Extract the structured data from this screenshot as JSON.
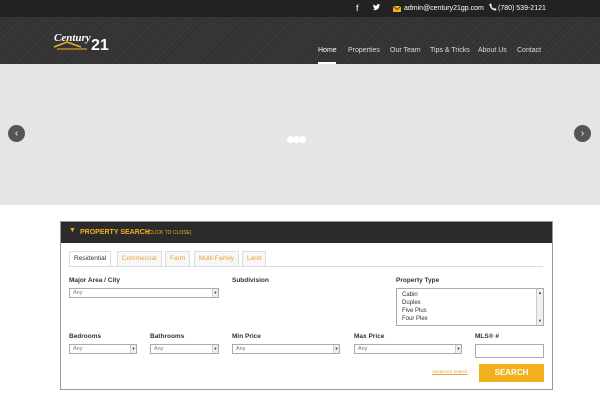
{
  "topbar": {
    "icons": [
      "facebook-icon",
      "twitter-icon",
      "envelope-icon",
      "phone-icon"
    ],
    "email": "admin@century21gp.com",
    "phone": "(780) 539-2121"
  },
  "brand": {
    "logo_text": "Century 21"
  },
  "nav": {
    "items": [
      {
        "label": "Home",
        "active": true
      },
      {
        "label": "Properties"
      },
      {
        "label": "Our Team"
      },
      {
        "label": "Tips & Tricks"
      },
      {
        "label": "About Us"
      },
      {
        "label": "Contact"
      }
    ]
  },
  "slider": {
    "prev_icon": "chevron-left-icon",
    "next_icon": "chevron-right-icon"
  },
  "search": {
    "title": "PROPERTY SEARCH",
    "subtitle": "(CLICK TO CLOSE)",
    "tabs": [
      "Residential",
      "Commercial",
      "Farm",
      "Multi-Family",
      "Land"
    ],
    "active_tab": "Residential",
    "fields": {
      "area": {
        "label": "Major Area / City",
        "value": "Any"
      },
      "subdivision": {
        "label": "Subdivision"
      },
      "property_type": {
        "label": "Property Type",
        "options": [
          "Cabin",
          "Duplex",
          "Five Plus",
          "Four Plex"
        ]
      },
      "bedrooms": {
        "label": "Bedrooms",
        "value": "Any"
      },
      "bathrooms": {
        "label": "Bathrooms",
        "value": "Any"
      },
      "min_price": {
        "label": "Min Price",
        "value": "Any"
      },
      "max_price": {
        "label": "Max Price",
        "value": "Any"
      },
      "mls": {
        "label": "MLS® #",
        "value": ""
      }
    },
    "advanced_link": "Advanced Search",
    "button": "SEARCH"
  },
  "colors": {
    "accent": "#f2b01e",
    "dark": "#2b2b2b"
  }
}
